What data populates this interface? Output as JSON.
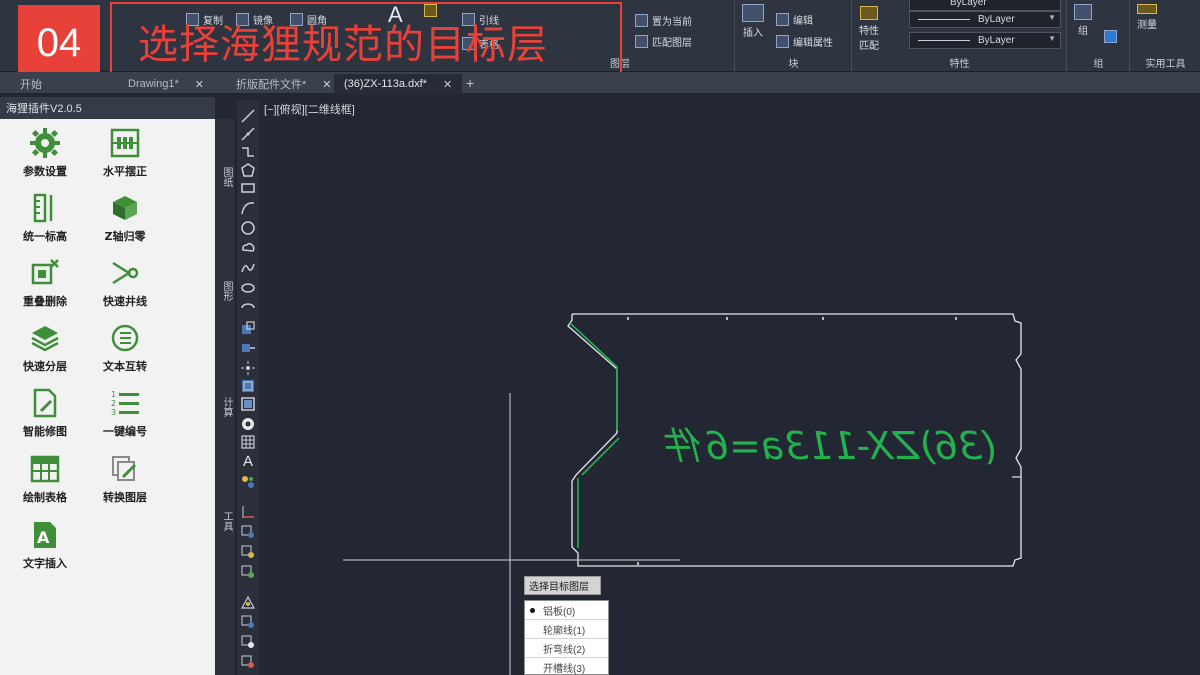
{
  "step": {
    "number": "04",
    "title": "选择海狸规范的目标层"
  },
  "ribbon": {
    "panels": {
      "layer": "图层",
      "block": "块",
      "properties": "特性",
      "group": "组",
      "utilities": "实用工具"
    },
    "items": {
      "copy": "复制",
      "mirror": "镜像",
      "fillet": "圆角",
      "circle_prefix": "圆",
      "lead": "引线",
      "table": "表格",
      "set_current": "置为当前",
      "match_layer": "匹配图层",
      "insert": "插入",
      "edit": "编辑",
      "edit_attribute": "编辑属性",
      "match_properties": "特性\n匹配",
      "group": "组",
      "measure": "测量",
      "bylayer_top": "ByLayer",
      "bylayer_1": "ByLayer",
      "bylayer_2": "ByLayer"
    }
  },
  "tabs": [
    {
      "label": "开始"
    },
    {
      "label": "Drawing1*"
    },
    {
      "label": "折版配件文件*"
    },
    {
      "label": "(36)ZX-113a.dxf*"
    }
  ],
  "plugin": {
    "title": "海狸插件V2.0.5",
    "buttons": [
      {
        "label": "参数设置",
        "icon": "gear-icon"
      },
      {
        "label": "水平摆正",
        "icon": "level-icon"
      },
      {
        "label": "统一标高",
        "icon": "ruler-icon"
      },
      {
        "label": "Z轴归零",
        "icon": "cube-icon"
      },
      {
        "label": "重叠删除",
        "icon": "overlap-delete-icon"
      },
      {
        "label": "快速井线",
        "icon": "vertex-icon"
      },
      {
        "label": "快速分层",
        "icon": "layers-icon"
      },
      {
        "label": "文本互转",
        "icon": "convert-icon"
      },
      {
        "label": "智能修图",
        "icon": "edit-doc-icon"
      },
      {
        "label": "一键编号",
        "icon": "numbered-list-icon"
      },
      {
        "label": "绘制表格",
        "icon": "table-icon"
      },
      {
        "label": "转换图层",
        "icon": "convert-layer-icon"
      },
      {
        "label": "文字插入",
        "icon": "text-insert-icon"
      }
    ]
  },
  "vertical_tabs": [
    "图纸",
    "图形",
    "计算",
    "工具"
  ],
  "viewport": {
    "label": "[−][俯视][二维线框]",
    "drawing_text": "(36)ZX-113a=6件"
  },
  "popup": {
    "title": "选择目标图层",
    "items": [
      {
        "label": "铝板(0)",
        "selected": true
      },
      {
        "label": "轮廓线(1)",
        "selected": false
      },
      {
        "label": "折弯线(2)",
        "selected": false
      },
      {
        "label": "开槽线(3)",
        "selected": false
      }
    ]
  },
  "colors": {
    "accent_red": "#e8413a",
    "drawing_white": "#e6e8ec",
    "drawing_green": "#22b14c",
    "plugin_icon_green": "#3f8f3a"
  }
}
